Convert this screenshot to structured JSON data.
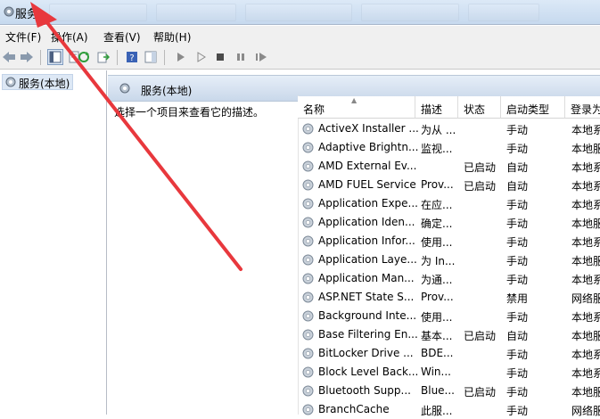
{
  "window": {
    "title": "服务"
  },
  "menu": [
    {
      "label": "文件(F)"
    },
    {
      "label": "操作(A)"
    },
    {
      "label": "查看(V)"
    },
    {
      "label": "帮助(H)"
    }
  ],
  "tree": {
    "label": "服务(本地)"
  },
  "panel": {
    "header": "服务(本地)",
    "description": "选择一个项目来查看它的描述。"
  },
  "table": {
    "columns": [
      "名称",
      "描述",
      "状态",
      "启动类型",
      "登录为"
    ],
    "rows": [
      [
        "ActiveX Installer ...",
        "为从 ...",
        "",
        "手动",
        "本地系"
      ],
      [
        "Adaptive Brightn...",
        "监视...",
        "",
        "手动",
        "本地服"
      ],
      [
        "AMD External Ev...",
        "",
        "已启动",
        "自动",
        "本地系"
      ],
      [
        "AMD FUEL Service",
        "Prov...",
        "已启动",
        "自动",
        "本地系"
      ],
      [
        "Application Expe...",
        "在应...",
        "",
        "手动",
        "本地系"
      ],
      [
        "Application Iden...",
        "确定...",
        "",
        "手动",
        "本地服"
      ],
      [
        "Application Infor...",
        "使用...",
        "",
        "手动",
        "本地系"
      ],
      [
        "Application Laye...",
        "为 In...",
        "",
        "手动",
        "本地服"
      ],
      [
        "Application Man...",
        "为通...",
        "",
        "手动",
        "本地系"
      ],
      [
        "ASP.NET State S...",
        "Prov...",
        "",
        "禁用",
        "网络服"
      ],
      [
        "Background Inte...",
        "使用...",
        "",
        "手动",
        "本地系"
      ],
      [
        "Base Filtering En...",
        "基本...",
        "已启动",
        "自动",
        "本地服"
      ],
      [
        "BitLocker Drive ...",
        "BDE...",
        "",
        "手动",
        "本地系"
      ],
      [
        "Block Level Back...",
        "Win...",
        "",
        "手动",
        "本地系"
      ],
      [
        "Bluetooth Supp...",
        "Blue...",
        "已启动",
        "手动",
        "本地服"
      ],
      [
        "BranchCache",
        "此服...",
        "",
        "手动",
        "网络服"
      ]
    ]
  },
  "colors": {
    "arrow": "#e8383d",
    "header_gradient_top": "#e6eef8",
    "header_gradient_bottom": "#c9d8ea"
  }
}
